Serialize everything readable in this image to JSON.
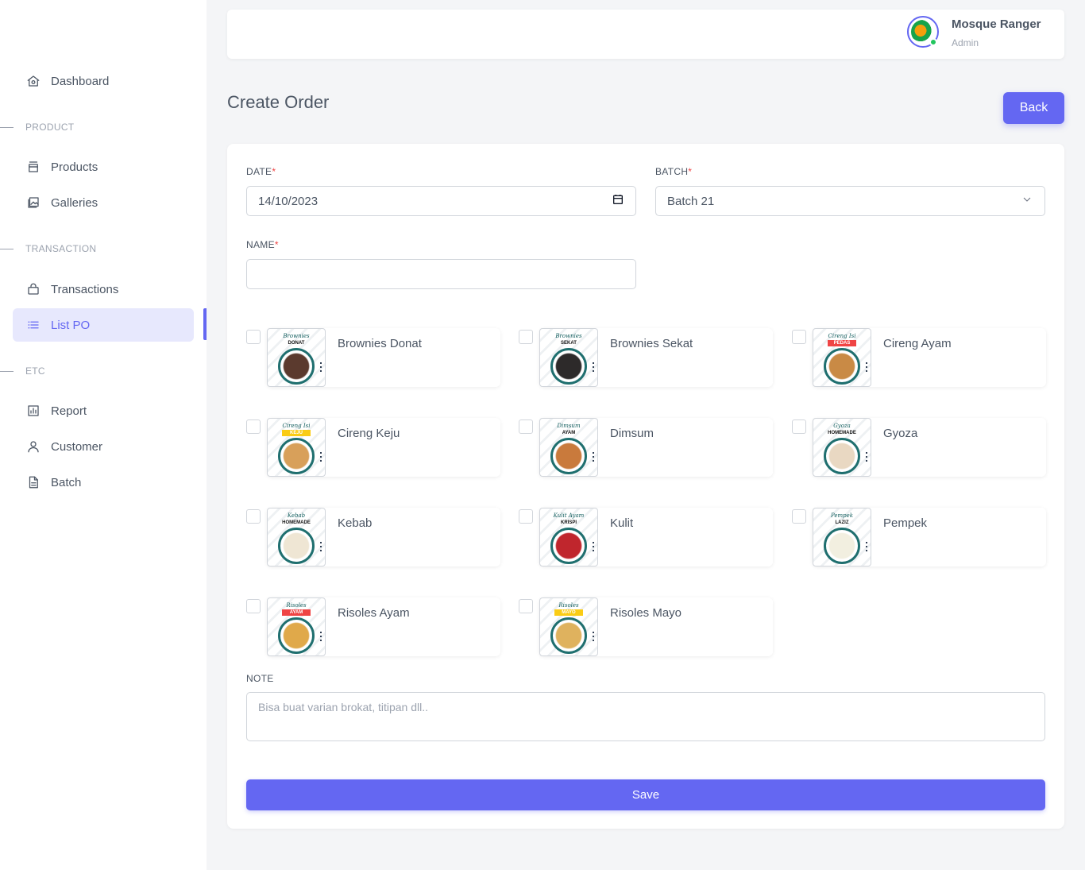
{
  "sidebar": {
    "dashboard": "Dashboard",
    "section_product": "PRODUCT",
    "products": "Products",
    "galleries": "Galleries",
    "section_transaction": "TRANSACTION",
    "transactions": "Transactions",
    "list_po": "List PO",
    "section_etc": "ETC",
    "report": "Report",
    "customer": "Customer",
    "batch": "Batch",
    "active_item": "List PO"
  },
  "header": {
    "user_name": "Mosque Ranger",
    "user_role": "Admin"
  },
  "page": {
    "title": "Create Order",
    "back_label": "Back"
  },
  "form": {
    "date_label": "DATE",
    "date_value": "14/10/2023",
    "batch_label": "BATCH",
    "batch_value": "Batch 21",
    "name_label": "NAME",
    "name_value": "",
    "required_mark": "*",
    "note_label": "NOTE",
    "note_placeholder": "Bisa buat varian brokat, titipan dll..",
    "save_label": "Save"
  },
  "products": [
    {
      "name": "Brownies Donat",
      "thumb_title": "Brownies",
      "thumb_sub": "DONAT",
      "sub_style": "plain",
      "checked": false,
      "food_color": "#5b3a2e"
    },
    {
      "name": "Brownies Sekat",
      "thumb_title": "Brownies",
      "thumb_sub": "SEKAT",
      "sub_style": "plain",
      "checked": false,
      "food_color": "#2d2a2a"
    },
    {
      "name": "Cireng Ayam",
      "thumb_title": "Cireng Isi",
      "thumb_sub": "PEDAS",
      "sub_style": "red",
      "checked": false,
      "food_color": "#c98a45"
    },
    {
      "name": "Cireng Keju",
      "thumb_title": "Cireng Isi",
      "thumb_sub": "KEJU",
      "sub_style": "yellow",
      "checked": false,
      "food_color": "#d8a05a"
    },
    {
      "name": "Dimsum",
      "thumb_title": "Dimsum",
      "thumb_sub": "AYAM",
      "sub_style": "plain",
      "checked": false,
      "food_color": "#c97a3c"
    },
    {
      "name": "Gyoza",
      "thumb_title": "Gyoza",
      "thumb_sub": "HOMEMADE",
      "sub_style": "plain",
      "checked": false,
      "food_color": "#e9d8c2"
    },
    {
      "name": "Kebab",
      "thumb_title": "Kebab",
      "thumb_sub": "HOMEMADE",
      "sub_style": "plain",
      "checked": false,
      "food_color": "#efe6d4"
    },
    {
      "name": "Kulit",
      "thumb_title": "Kulit Ayam",
      "thumb_sub": "KRISPI",
      "sub_style": "plain",
      "checked": false,
      "food_color": "#c0262d"
    },
    {
      "name": "Pempek",
      "thumb_title": "Pempek",
      "thumb_sub": "LAZIZ",
      "sub_style": "plain",
      "checked": false,
      "food_color": "#f2efe0"
    },
    {
      "name": "Risoles Ayam",
      "thumb_title": "Risoles",
      "thumb_sub": "AYAM",
      "sub_style": "red",
      "checked": false,
      "food_color": "#e0a94a"
    },
    {
      "name": "Risoles Mayo",
      "thumb_title": "Risoles",
      "thumb_sub": "MAYO",
      "sub_style": "yellow",
      "checked": false,
      "food_color": "#dfb25e"
    }
  ],
  "colors": {
    "accent": "#6467f2",
    "active_bg": "#e7e8fd",
    "required": "#ef4444",
    "online": "#22c55e"
  },
  "icons": {
    "dashboard": "home-icon",
    "products": "box-icon",
    "galleries": "image-icon",
    "transactions": "bag-icon",
    "list_po": "list-icon",
    "report": "chart-icon",
    "customer": "user-icon",
    "batch": "file-icon",
    "date": "calendar-icon",
    "batch_select": "chevron-down-icon"
  }
}
